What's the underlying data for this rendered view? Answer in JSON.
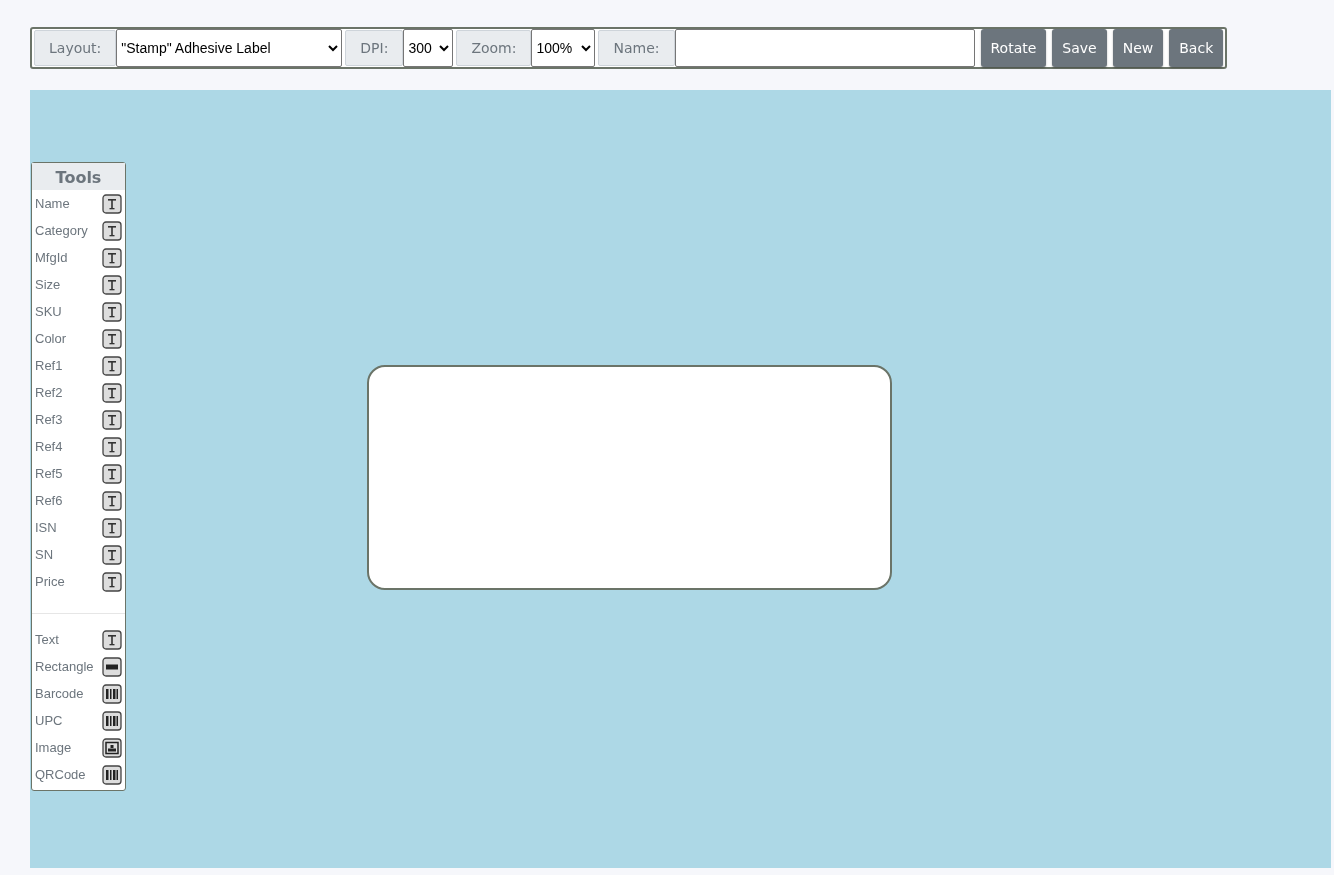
{
  "toolbar": {
    "layout": {
      "label": "Layout:",
      "value": "\"Stamp\" Adhesive Label"
    },
    "dpi": {
      "label": "DPI:",
      "value": "300"
    },
    "zoom": {
      "label": "Zoom:",
      "value": "100%"
    },
    "name": {
      "label": "Name:"
    },
    "buttons": [
      "Rotate",
      "Save",
      "New",
      "Back"
    ]
  },
  "tools": {
    "title": "Tools",
    "groups": [
      [
        {
          "label": "Name",
          "kind": "text"
        },
        {
          "label": "Category",
          "kind": "text"
        },
        {
          "label": "MfgId",
          "kind": "text"
        },
        {
          "label": "Size",
          "kind": "text"
        },
        {
          "label": "SKU",
          "kind": "text"
        },
        {
          "label": "Color",
          "kind": "text"
        },
        {
          "label": "Ref1",
          "kind": "text"
        },
        {
          "label": "Ref2",
          "kind": "text"
        },
        {
          "label": "Ref3",
          "kind": "text"
        },
        {
          "label": "Ref4",
          "kind": "text"
        },
        {
          "label": "Ref5",
          "kind": "text"
        },
        {
          "label": "Ref6",
          "kind": "text"
        },
        {
          "label": "ISN",
          "kind": "text"
        },
        {
          "label": "SN",
          "kind": "text"
        },
        {
          "label": "Price",
          "kind": "text"
        }
      ],
      [
        {
          "label": "Text",
          "kind": "text"
        },
        {
          "label": "Rectangle",
          "kind": "rect"
        },
        {
          "label": "Barcode",
          "kind": "barcode"
        },
        {
          "label": "UPC",
          "kind": "barcode"
        },
        {
          "label": "Image",
          "kind": "image"
        },
        {
          "label": "QRCode",
          "kind": "barcode"
        }
      ]
    ]
  }
}
